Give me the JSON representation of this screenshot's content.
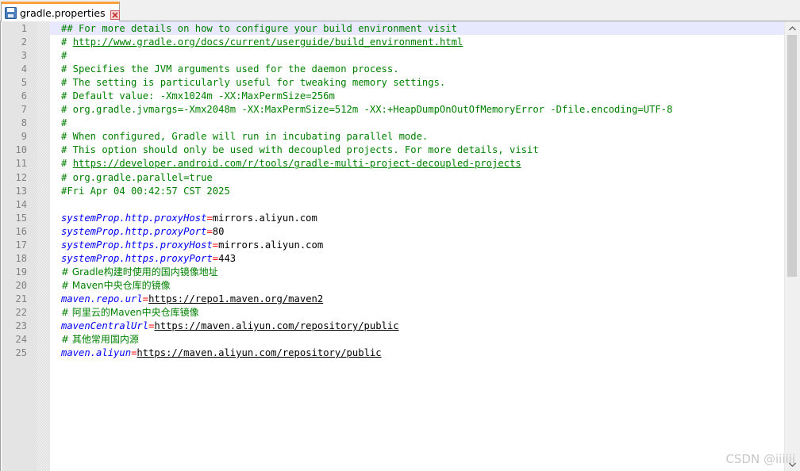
{
  "tab": {
    "label": "gradle.properties",
    "save_icon": "floppy-disk-icon",
    "close_icon": "close-icon"
  },
  "colors": {
    "comment": "#008000",
    "key": "#0000ff",
    "operator": "#ff0000",
    "value": "#000000",
    "line_number": "#808080",
    "current_line": "#e8e8ff",
    "tab_accent": "#f9a03f"
  },
  "line_numbers": [
    "1",
    "2",
    "3",
    "4",
    "5",
    "6",
    "7",
    "8",
    "9",
    "10",
    "11",
    "12",
    "13",
    "14",
    "15",
    "16",
    "17",
    "18",
    "19",
    "20",
    "21",
    "22",
    "23",
    "24",
    "25"
  ],
  "lines": {
    "l1": "## For more details on how to configure your build environment visit",
    "l2_prefix": "# ",
    "l2_url": "http://www.gradle.org/docs/current/userguide/build_environment.html",
    "l3": "#",
    "l4": "# Specifies the JVM arguments used for the daemon process.",
    "l5": "# The setting is particularly useful for tweaking memory settings.",
    "l6": "# Default value: -Xmx1024m -XX:MaxPermSize=256m",
    "l7": "# org.gradle.jvmargs=-Xmx2048m -XX:MaxPermSize=512m -XX:+HeapDumpOnOutOfMemoryError -Dfile.encoding=UTF-8",
    "l8": "#",
    "l9": "# When configured, Gradle will run in incubating parallel mode.",
    "l10": "# This option should only be used with decoupled projects. For more details, visit",
    "l11_prefix": "# ",
    "l11_url": "https://developer.android.com/r/tools/gradle-multi-project-decoupled-projects",
    "l12": "# org.gradle.parallel=true",
    "l13": "#Fri Apr 04 00:42:57 CST 2025",
    "l14": "",
    "l15_key": "systemProp.http.proxyHost",
    "l15_val": "mirrors.aliyun.com",
    "l16_key": "systemProp.http.proxyPort",
    "l16_val": "80",
    "l17_key": "systemProp.https.proxyHost",
    "l17_val": "mirrors.aliyun.com",
    "l18_key": "systemProp.https.proxyPort",
    "l18_val": "443",
    "l19": "# Gradle构建时使用的国内镜像地址",
    "l20": "# Maven中央仓库的镜像",
    "l21_key": "maven.repo.url",
    "l21_val": "https://repo1.maven.org/maven2",
    "l22": "# 阿里云的Maven中央仓库镜像",
    "l23_key": "mavenCentralUrl",
    "l23_val": "https://maven.aliyun.com/repository/public",
    "l24": "# 其他常用国内源",
    "l25_key": "maven.aliyun",
    "l25_val": "https://maven.aliyun.com/repository/public",
    "eq": "="
  },
  "watermark": "CSDN @iiiiii"
}
